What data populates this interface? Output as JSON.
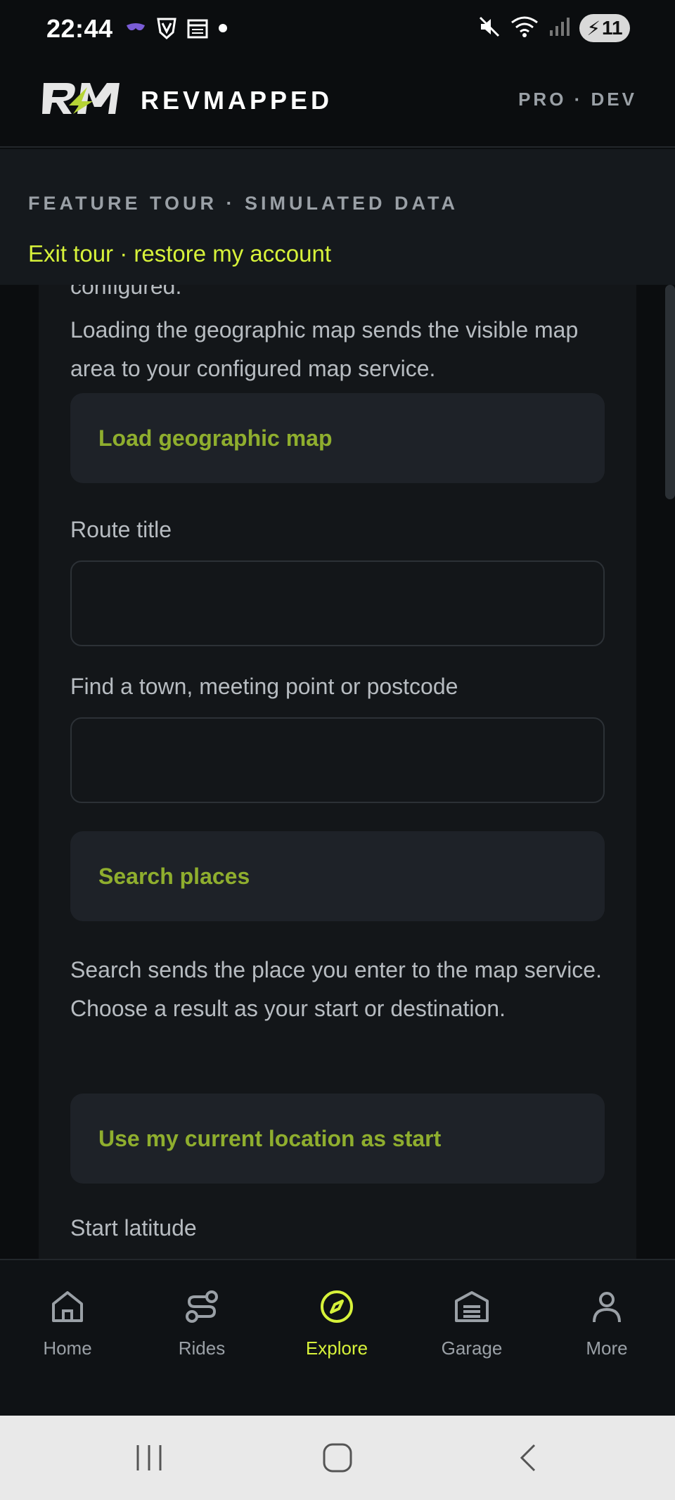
{
  "status_bar": {
    "time": "22:44",
    "battery": "11",
    "icons": [
      "mask-icon",
      "shield-icon",
      "calendar-icon",
      "dot-icon",
      "mute-icon",
      "wifi-icon",
      "signal-icon",
      "battery-icon"
    ]
  },
  "header": {
    "brand": "REVMAPPED",
    "tier": "PRO · DEV"
  },
  "tour": {
    "title": "FEATURE TOUR · SIMULATED DATA",
    "exit_link": "Exit tour · restore my account"
  },
  "main": {
    "partial_text": "configured.",
    "map_notice": "Loading the geographic map sends the visible map area to your configured map service.",
    "load_map_button": "Load geographic map",
    "route_title_label": "Route title",
    "route_title_value": "",
    "find_label": "Find a town, meeting point or postcode",
    "find_value": "",
    "search_button": "Search places",
    "search_help": "Search sends the place you enter to the map service. Choose a result as your start or destination.",
    "current_location_button": "Use my current location as start",
    "start_latitude_label": "Start latitude"
  },
  "bottom_nav": {
    "items": [
      {
        "label": "Home",
        "icon": "home-icon",
        "active": false
      },
      {
        "label": "Rides",
        "icon": "route-icon",
        "active": false
      },
      {
        "label": "Explore",
        "icon": "compass-icon",
        "active": true
      },
      {
        "label": "Garage",
        "icon": "garage-icon",
        "active": false
      },
      {
        "label": "More",
        "icon": "person-icon",
        "active": false
      }
    ]
  },
  "colors": {
    "accent": "#d7f23a",
    "button_text": "#8fae2e",
    "background": "#0b0d0f",
    "card": "#131619"
  }
}
